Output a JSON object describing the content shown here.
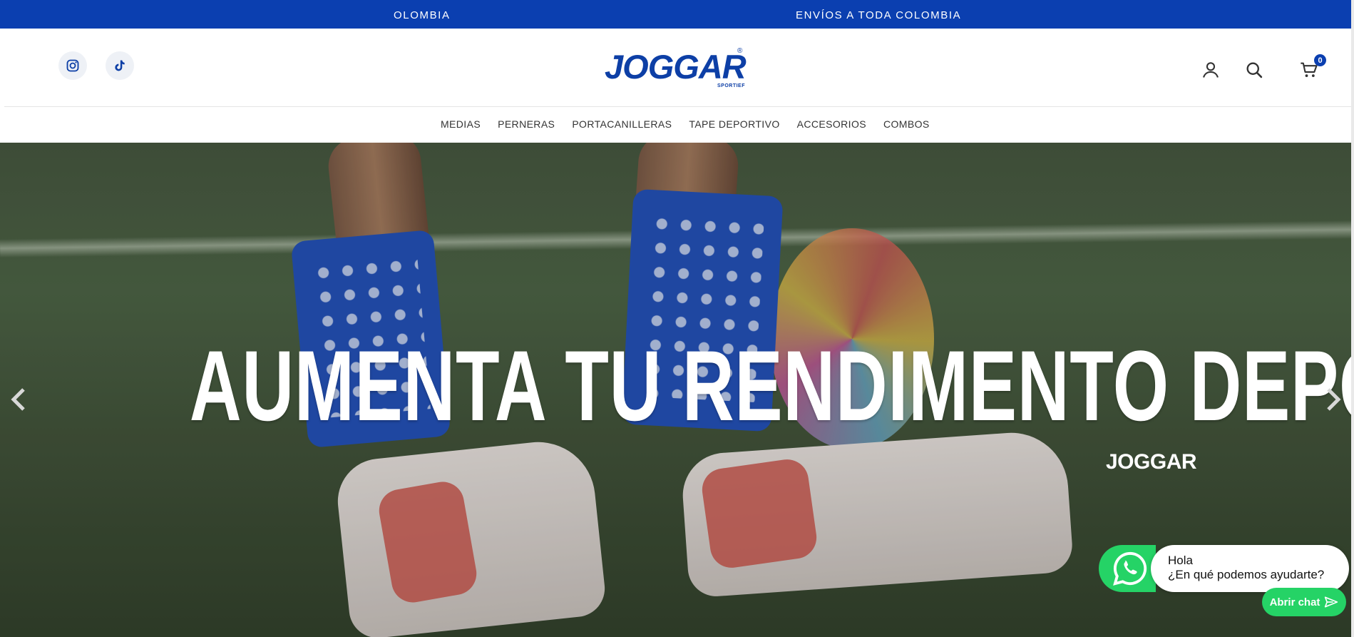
{
  "announcement": {
    "items": [
      "OLOMBIA",
      "ENVÍOS A TODA COLOMBIA"
    ],
    "background": "#0b3fb0"
  },
  "header": {
    "social": [
      {
        "name": "instagram",
        "icon": "instagram-icon"
      },
      {
        "name": "tiktok",
        "icon": "tiktok-icon"
      }
    ],
    "logo": {
      "brand": "JOGGAR",
      "registered": "®",
      "tagline": "SPORTIEF"
    },
    "actions": {
      "account_icon": "user-icon",
      "search_icon": "search-icon",
      "cart_icon": "cart-icon",
      "cart_count": "0"
    },
    "brand_color": "#0d3fa6"
  },
  "nav": {
    "items": [
      "MEDIAS",
      "PERNERAS",
      "PORTACANILLERAS",
      "TAPE DEPORTIVO",
      "ACCESORIOS",
      "COMBOS"
    ]
  },
  "hero": {
    "title": "AUMENTA TU RENDIMENTO DEPORTIVO",
    "logo": "JOGGAR",
    "prev_icon": "chevron-left-icon",
    "next_icon": "chevron-right-icon"
  },
  "whatsapp": {
    "greeting": "Hola",
    "question": "¿En qué podemos ayudarte?",
    "button_label": "Abrir chat",
    "color": "#25d366"
  }
}
